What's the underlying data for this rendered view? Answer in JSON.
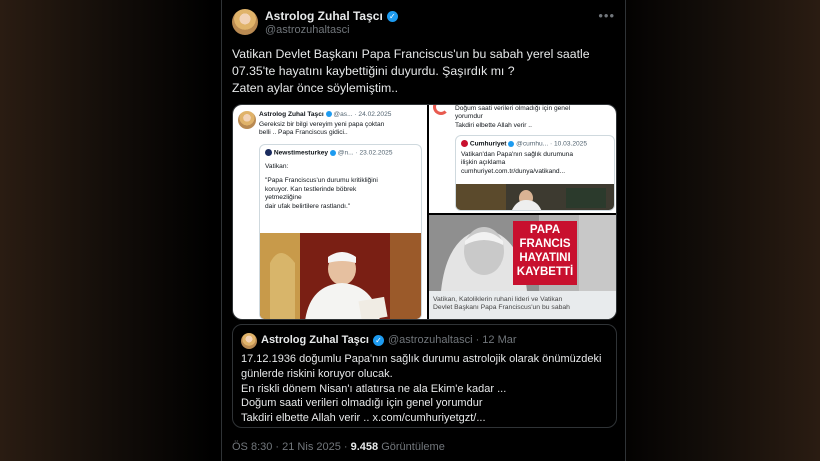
{
  "author": {
    "name": "Astrolog Zuhal Taşcı",
    "handle": "@astrozuhaltasci"
  },
  "post": {
    "lines": [
      "Vatikan Devlet Başkanı Papa Franciscus'un bu sabah yerel saatle",
      "07.35'te hayatını kaybettiğini duyurdu. Şaşırdık mı ?",
      "Zaten aylar önce söylemiştim.."
    ]
  },
  "media": {
    "left": {
      "author": "Astrolog Zuhal Taşcı",
      "meta": "@as... · 24.02.2025",
      "lines": [
        "Gereksiz bir bilgi vereyim yeni papa çoktan",
        "belli .. Papa Franciscus gidici.."
      ],
      "inner_author": "Newstimesturkey",
      "inner_meta": "@n... · 23.02.2025",
      "inner_lines": [
        "Vatikan:",
        "\"Papa Franciscus'un durumu kritikliğini",
        "koruyor. Kan testlerinde böbrek",
        "yetmezliğine",
        "dair ufak belirtilere rastlandı.\""
      ]
    },
    "top_right": {
      "lines": [
        "Doğum saati verileri olmadığı için genel",
        "yorumdur",
        "Takdiri elbette Allah verir .."
      ],
      "inner_author": "Cumhuriyet",
      "inner_meta": "@cumhu... · 10.03.2025",
      "inner_lines": [
        "Vatikan'dan Papa'nın sağlık durumuna",
        "ilişkin açıklama",
        "cumhuriyet.com.tr/dunya/vatikand..."
      ]
    },
    "bottom_right": {
      "headline": [
        "PAPA",
        "FRANCIS",
        "HAYATINI",
        "KAYBETTİ"
      ],
      "caption": [
        "Vatikan, Katoliklerin ruhani lideri ve Vatikan",
        "Devlet Başkanı Papa Franciscus'un bu sabah"
      ]
    }
  },
  "quote": {
    "name": "Astrolog Zuhal Taşcı",
    "handle": "@astrozuhaltasci · 12 Mar",
    "lines": [
      "17.12.1936 doğumlu Papa'nın sağlık durumu astrolojik olarak önümüzdeki",
      "günlerde riskini koruyor olucak.",
      "En riskli dönem Nisan'ı atlatırsa ne ala Ekim'e kadar ...",
      "Doğum saati verileri olmadığı için genel yorumdur",
      "Takdiri elbette Allah verir .. x.com/cumhuriyetgzt/..."
    ]
  },
  "meta": {
    "time": "ÖS 8:30 · 21 Nis 2025 ·",
    "views": "9.458",
    "views_label": "Görüntüleme"
  },
  "colors": {
    "verified": "#1d9bf0",
    "background": "#000000",
    "accent_red": "#c8102e"
  }
}
